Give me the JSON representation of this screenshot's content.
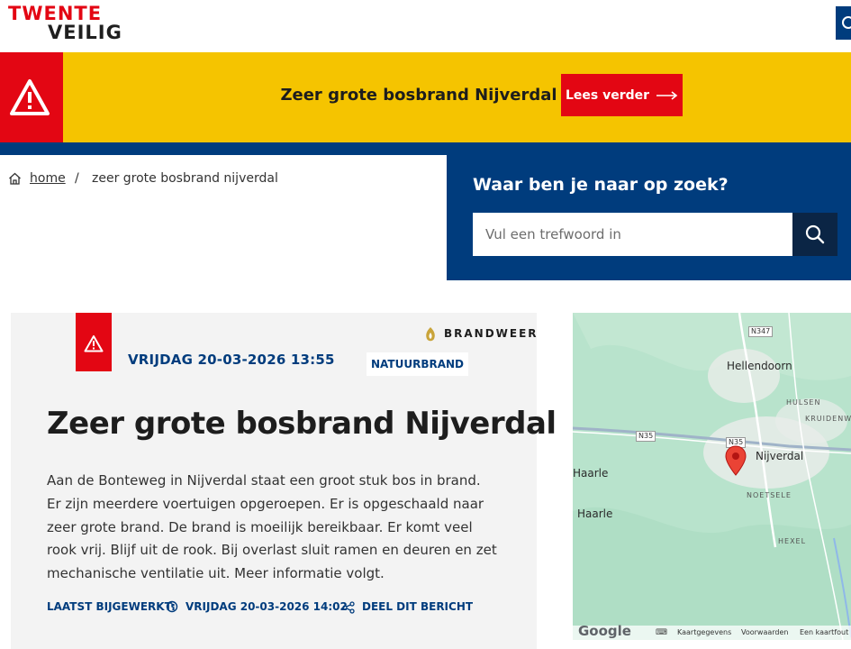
{
  "header": {
    "logo_line1": "TWENTE",
    "logo_line2": "VEILIG"
  },
  "alert": {
    "title": "Zeer grote bosbrand Nijverdal",
    "button_label": "Lees verder",
    "icon": "warning-triangle-icon"
  },
  "breadcrumb": {
    "home": "home",
    "separator": "/",
    "current": "zeer grote bosbrand nijverdal"
  },
  "search": {
    "title": "Waar ben je naar op zoek?",
    "placeholder": "Vul een trefwoord in"
  },
  "article": {
    "date": "VRIJDAG 20-03-2026 13:55",
    "source": "BRANDWEER",
    "tag": "NATUURBRAND",
    "title": "Zeer grote bosbrand Nijverdal",
    "body": "Aan de Bonteweg in Nijverdal staat een groot stuk bos in brand. Er zijn meerdere voertuigen opgeroepen. Er is opgeschaald naar zeer grote brand. De brand is moeilijk bereikbaar. Er komt veel rook vrij. Blijf uit de rook. Bij overlast sluit ramen en deuren en zet mechanische ventilatie uit. Meer informatie volgt.",
    "updated_label": "LAATST BIJGEWERKT:",
    "updated_date": "VRIJDAG 20-03-2026 14:02",
    "share_label": "DEEL DIT BERICHT"
  },
  "map": {
    "labels": {
      "hellendoorn": "Hellendoorn",
      "hulsen": "HULSEN",
      "kruidenwijk": "KRUIDENWIJ",
      "nijverdal": "Nijverdal",
      "haarle1": "Haarle",
      "haarle2": "Haarle",
      "noetsele": "NOETSELE",
      "hexel": "HEXEL"
    },
    "shields": {
      "n347": "N347",
      "n35a": "N35",
      "n35b": "N35"
    },
    "footer": {
      "google": "Google",
      "kaartgegevens": "Kaartgegevens",
      "voorwaarden": "Voorwaarden",
      "fout": "Een kaartfout"
    }
  },
  "colors": {
    "brand_red": "#e30613",
    "brand_yellow": "#f5c400",
    "brand_blue": "#003c7d"
  }
}
